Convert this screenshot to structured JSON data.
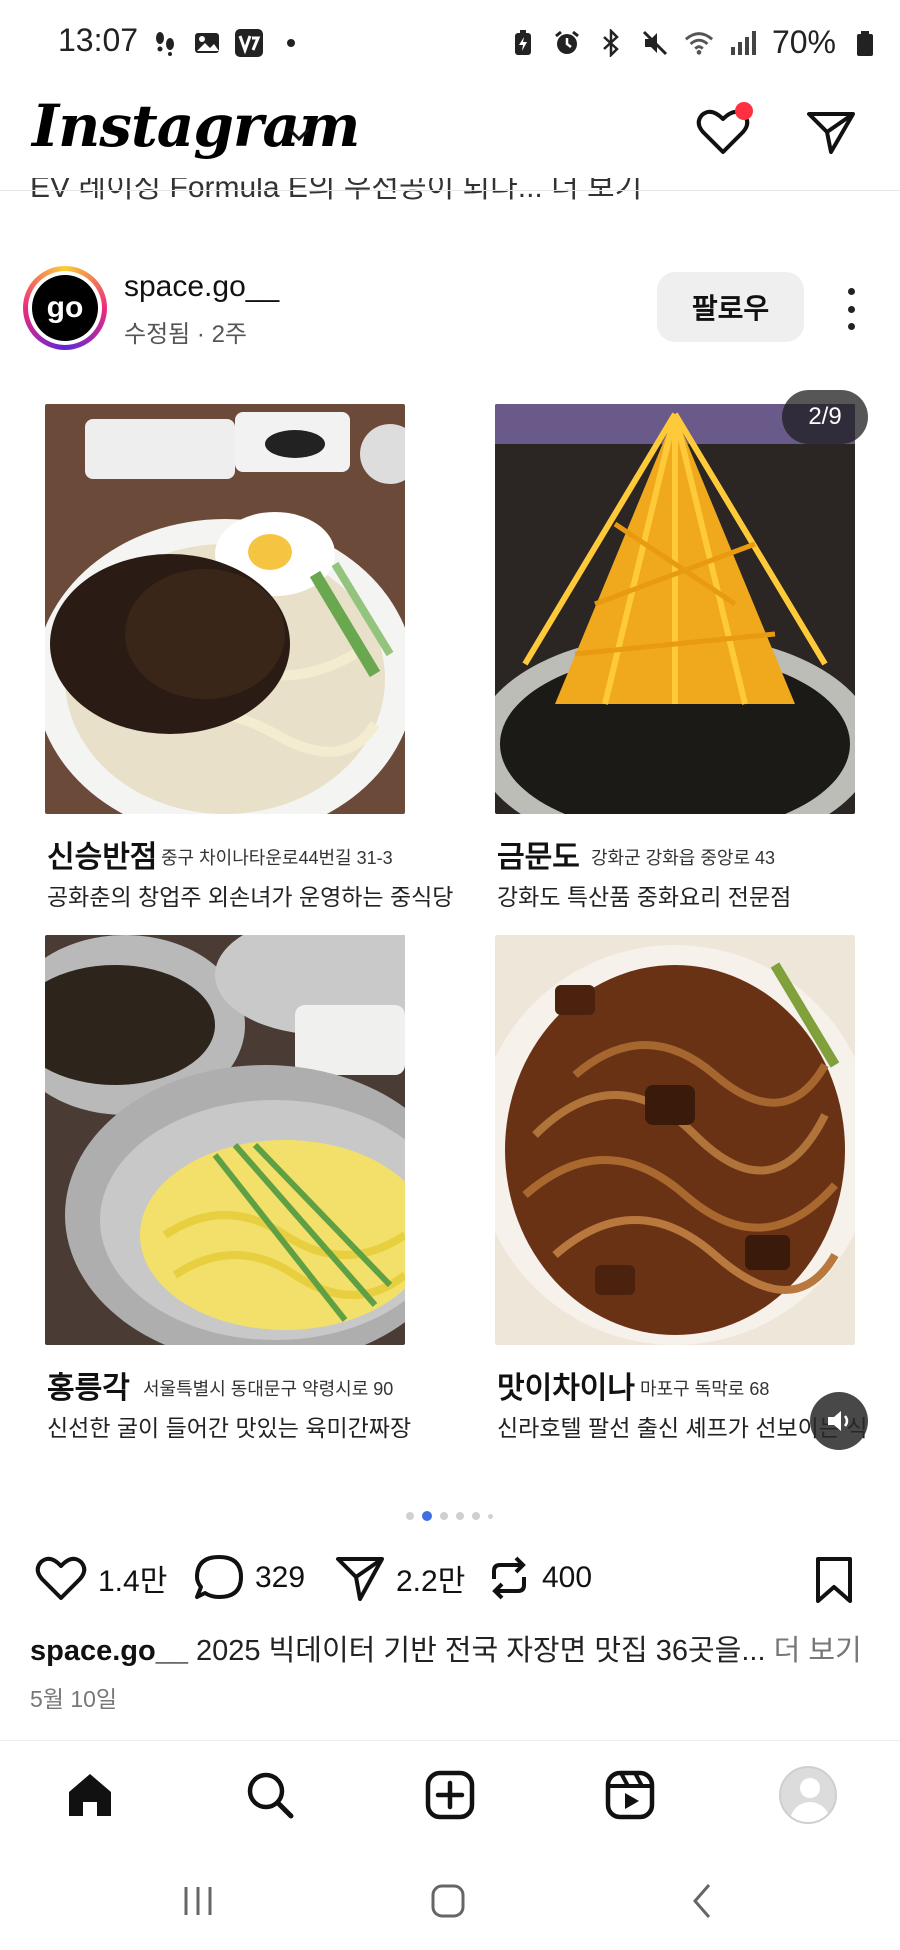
{
  "status_bar": {
    "time": "13:07",
    "battery": "70%"
  },
  "header": {
    "logo": "Instagram",
    "prev_caption_fragment": "EV 레이싱 Formula E의 우선공이 되다... 더 보기"
  },
  "post": {
    "username": "space.go__",
    "avatar_text": "go",
    "meta": "수정됨 · 2주",
    "follow_label": "팔로우",
    "page_indicator": "2/9",
    "cards": [
      {
        "name": "신승반점",
        "address": "중구 차이나타운로44번길 31-3",
        "desc": "공화춘의 창업주 외손녀가 운영하는 중식당"
      },
      {
        "name": "금문도",
        "address": "강화군 강화읍 중앙로 43",
        "desc": "강화도 특산품 중화요리 전문점"
      },
      {
        "name": "홍릉각",
        "address": "서울특별시 동대문구 약령시로 90",
        "desc": "신선한 굴이 들어간 맛있는 육미간짜장"
      },
      {
        "name": "맛이차이나",
        "address": "마포구 독막로 68",
        "desc": "신라호텔 팔선 출신 셰프가 선보이는 식"
      }
    ],
    "likes": "1.4만",
    "comments": "329",
    "shares": "2.2만",
    "reposts": "400",
    "caption_user": "space.go__",
    "caption_text": " 2025 빅데이터 기반 전국 자장면 맛집 36곳을...",
    "caption_more": " 더 보기",
    "date": "5월 10일"
  },
  "colors": {
    "accent_blue": "#3f6fe0",
    "notification_red": "#ff3040",
    "follow_bg": "#efefef"
  },
  "icons": [
    "heart-icon",
    "send-icon",
    "more-icon",
    "comment-icon",
    "repost-icon",
    "bookmark-icon",
    "home-icon",
    "search-icon",
    "create-icon",
    "reels-icon",
    "profile-icon",
    "sound-icon"
  ]
}
